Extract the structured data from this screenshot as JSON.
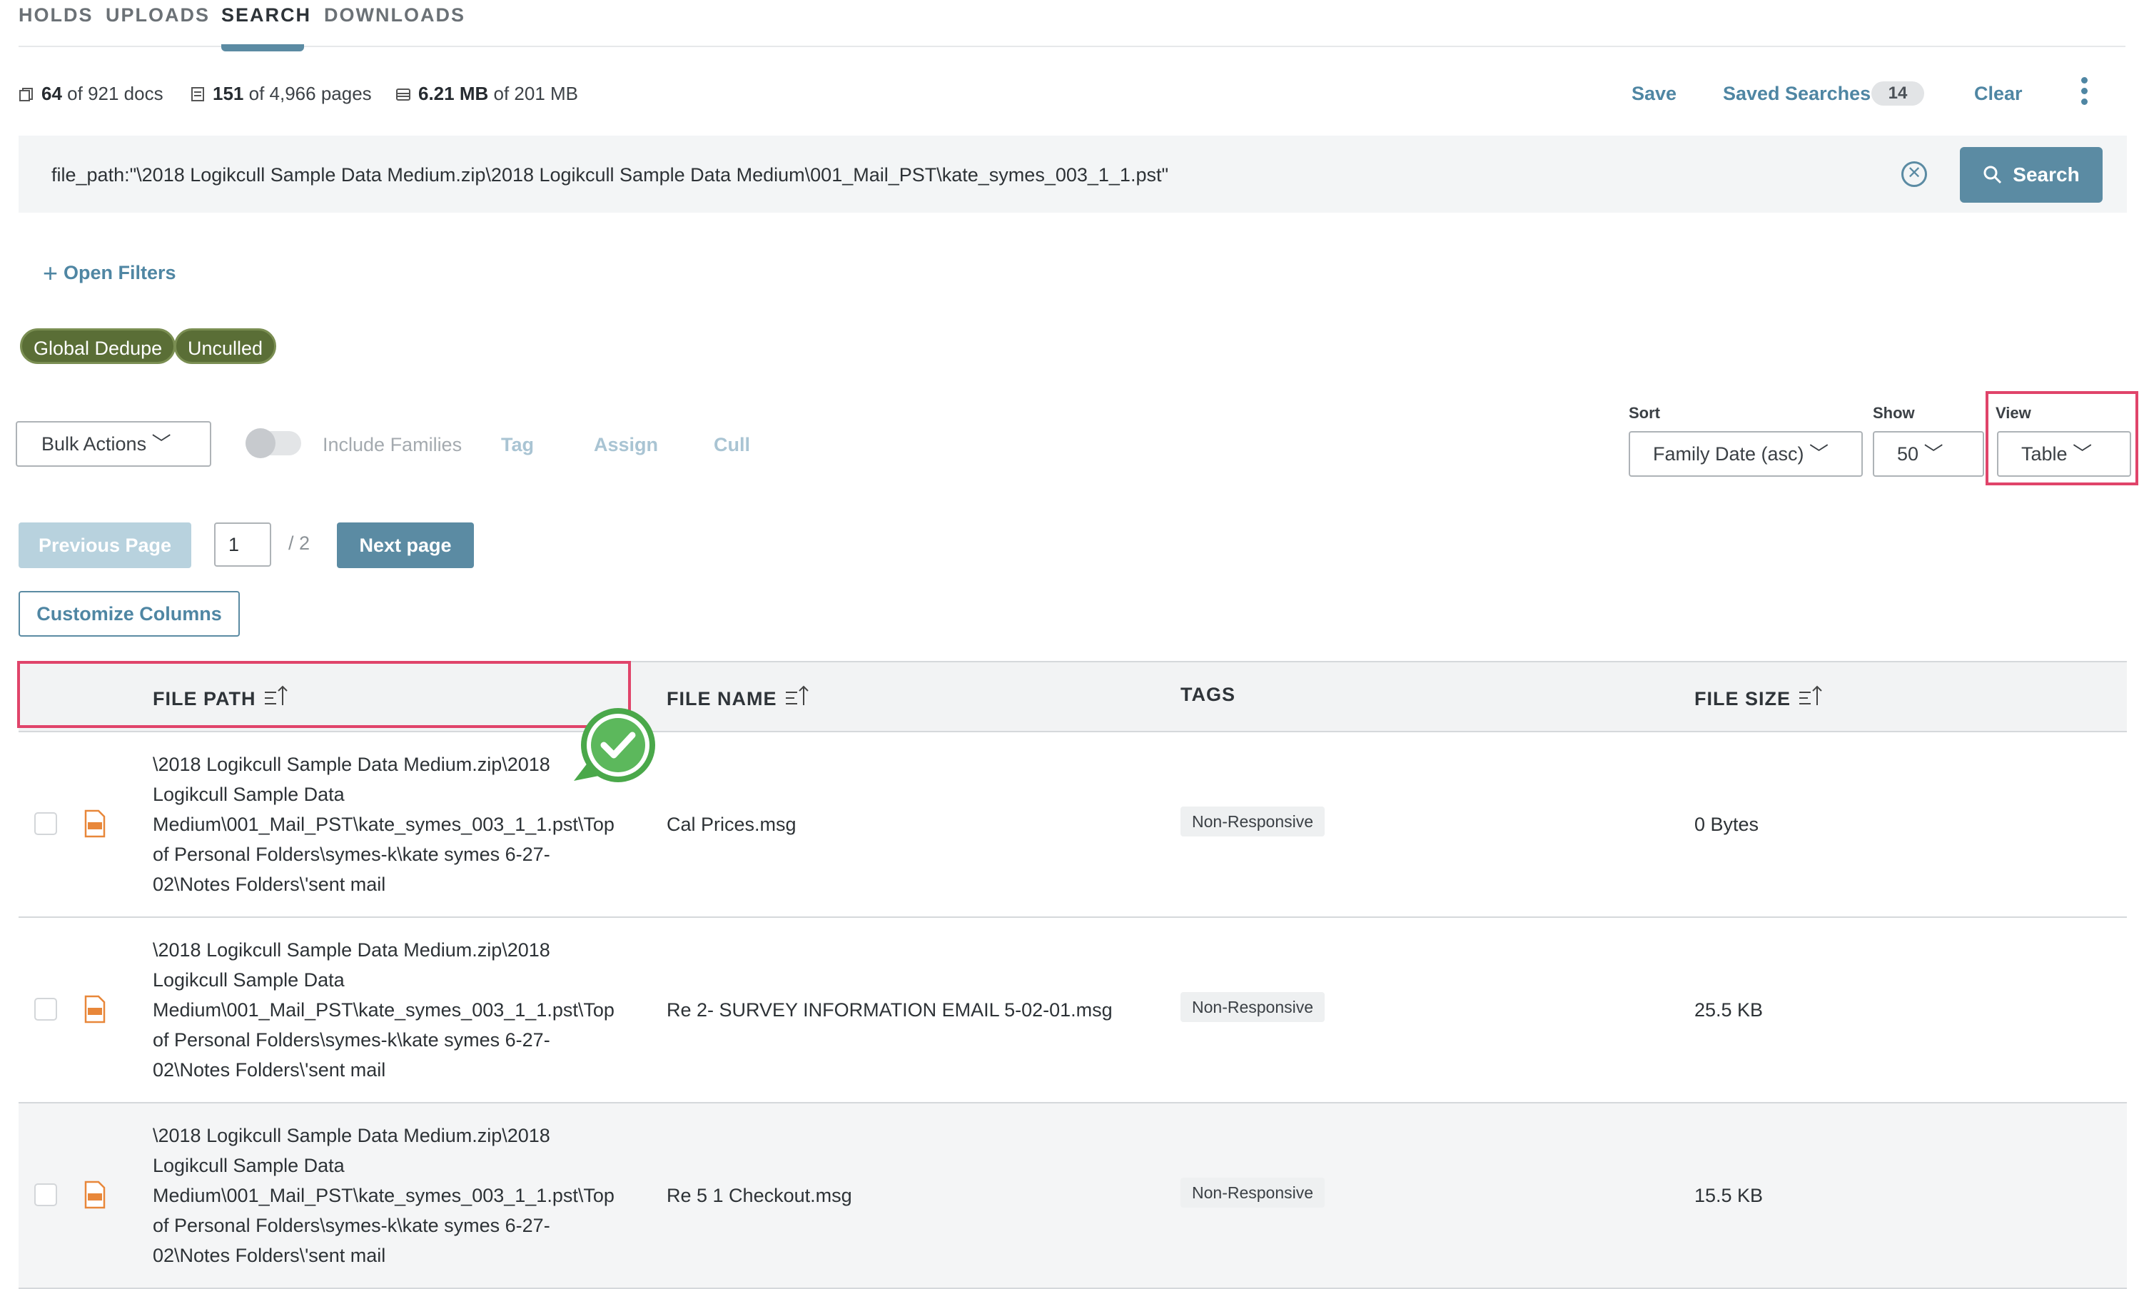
{
  "tabs": [
    {
      "label": "HOLDS"
    },
    {
      "label": "UPLOADS"
    },
    {
      "label": "SEARCH",
      "active": true
    },
    {
      "label": "DOWNLOADS"
    }
  ],
  "stats": {
    "docs_count": "64",
    "docs_total": "of 921 docs",
    "pages_count": "151",
    "pages_total": "of 4,966 pages",
    "size_count": "6.21 MB",
    "size_total": "of 201 MB"
  },
  "actions": {
    "save": "Save",
    "saved_searches": "Saved Searches",
    "saved_count": "14",
    "clear": "Clear"
  },
  "search": {
    "query": "file_path:\"\\2018 Logikcull Sample Data Medium.zip\\2018 Logikcull Sample Data Medium\\001_Mail_PST\\kate_symes_003_1_1.pst\"",
    "button": "Search"
  },
  "filters": {
    "open": "Open Filters",
    "pills": [
      "Global Dedupe",
      "Unculled"
    ]
  },
  "toolbar": {
    "bulk_actions": "Bulk Actions",
    "include_families": "Include Families",
    "tag": "Tag",
    "assign": "Assign",
    "cull": "Cull",
    "sort_label": "Sort",
    "sort_value": "Family Date (asc)",
    "show_label": "Show",
    "show_value": "50",
    "view_label": "View",
    "view_value": "Table"
  },
  "pagination": {
    "prev": "Previous Page",
    "current": "1",
    "total": "/ 2",
    "next": "Next page"
  },
  "customize": "Customize Columns",
  "table": {
    "headers": {
      "file_path": "FILE PATH",
      "file_name": "FILE NAME",
      "tags": "TAGS",
      "file_size": "FILE SIZE"
    },
    "rows": [
      {
        "path": [
          "\\2018 Logikcull Sample Data Medium.zip\\2018",
          "Logikcull Sample Data",
          "Medium\\001_Mail_PST\\kate_symes_003_1_1.pst\\Top",
          "of Personal Folders\\symes-k\\kate symes 6-27-",
          "02\\Notes Folders\\'sent mail"
        ],
        "name": "Cal Prices.msg",
        "tag": "Non-Responsive",
        "size": "0 Bytes"
      },
      {
        "path": [
          "\\2018 Logikcull Sample Data Medium.zip\\2018",
          "Logikcull Sample Data",
          "Medium\\001_Mail_PST\\kate_symes_003_1_1.pst\\Top",
          "of Personal Folders\\symes-k\\kate symes 6-27-",
          "02\\Notes Folders\\'sent mail"
        ],
        "name": "Re 2- SURVEY INFORMATION EMAIL 5-02-01.msg",
        "tag": "Non-Responsive",
        "size": "25.5 KB"
      },
      {
        "path": [
          "\\2018 Logikcull Sample Data Medium.zip\\2018",
          "Logikcull Sample Data",
          "Medium\\001_Mail_PST\\kate_symes_003_1_1.pst\\Top",
          "of Personal Folders\\symes-k\\kate symes 6-27-",
          "02\\Notes Folders\\'sent mail"
        ],
        "name": "Re 5 1 Checkout.msg",
        "tag": "Non-Responsive",
        "size": "15.5 KB"
      }
    ]
  },
  "colors": {
    "accent": "#5b8ba3",
    "pill": "#5a6e36",
    "highlight": "#e0446a",
    "check": "#5cb85c"
  }
}
